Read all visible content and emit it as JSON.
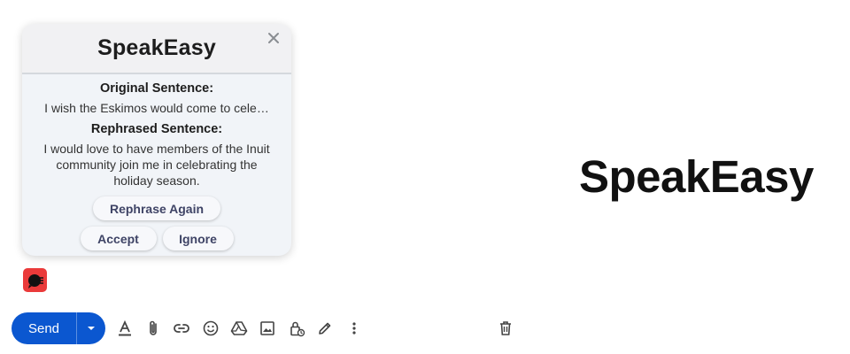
{
  "popup": {
    "title": "SpeakEasy",
    "original_label": "Original Sentence:",
    "original_text": "I wish the Eskimos would come to cele…",
    "rephrased_label": "Rephrased Sentence:",
    "rephrased_text": "I would love to have members of the Inuit community join me in celebrating the holiday season.",
    "buttons": {
      "rephrase": "Rephrase Again",
      "accept": "Accept",
      "ignore": "Ignore"
    }
  },
  "brand": "SpeakEasy",
  "compose_toolbar": {
    "send_label": "Send",
    "icons": [
      "formatting-icon",
      "attach-icon",
      "link-icon",
      "emoji-icon",
      "drive-icon",
      "photo-icon",
      "confidential-icon",
      "signature-icon",
      "more-options-icon",
      "trash-icon"
    ]
  },
  "colors": {
    "send_blue": "#0b57d0",
    "extension_red": "#ea3a3a",
    "button_text": "#3f4466"
  }
}
